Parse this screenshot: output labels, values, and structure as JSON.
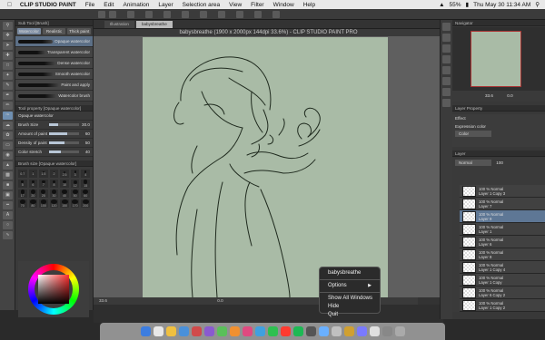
{
  "menubar": {
    "app": "CLIP STUDIO PAINT",
    "items": [
      "File",
      "Edit",
      "Animation",
      "Layer",
      "Selection area",
      "View",
      "Filter",
      "Window",
      "Help"
    ],
    "battery": "55%",
    "clock": "Thu May 30  11:34 AM"
  },
  "tool_panel": {
    "subtool_header": "Sub Tool [Brush]",
    "tabs": [
      "Watercolor",
      "Realistic",
      "Thick paint"
    ],
    "brushes": [
      "Opaque watercolor",
      "Transparent watercolor",
      "Dense watercolor",
      "Smooth watercolor",
      "Paint and apply",
      "Watercolor brush"
    ],
    "selected_brush": "Opaque watercolor",
    "prop_header": "Tool property [Opaque watercolor]",
    "prop_title": "Opaque watercolor",
    "props": [
      {
        "label": "Brush Size",
        "value": "30.0",
        "fill": 0.3
      },
      {
        "label": "Amount of paint",
        "value": "60",
        "fill": 0.6
      },
      {
        "label": "Density of paint",
        "value": "50",
        "fill": 0.5
      },
      {
        "label": "Color stretch",
        "value": "40",
        "fill": 0.4
      }
    ],
    "size_header": "Brush size [Opaque watercolor]",
    "sizes": [
      "0.7",
      "1",
      "1.5",
      "2",
      "2.5",
      "3",
      "4",
      "5",
      "6",
      "7",
      "8",
      "10",
      "12",
      "15",
      "17",
      "20",
      "25",
      "30",
      "40",
      "50",
      "60",
      "70",
      "80",
      "100",
      "120",
      "150",
      "170",
      "200"
    ]
  },
  "canvas": {
    "tabs": [
      "Illustration",
      "babysbreathe"
    ],
    "active_tab": "babysbreathe",
    "title": "babysbreathe (1900 x 2000px 144dpi 33.6%) - CLIP STUDIO PAINT PRO",
    "status_zoom": "33.6",
    "status_angle": "0.0"
  },
  "right_panel": {
    "navigator_tab": "Navigator",
    "nav_zoom": "33.6",
    "nav_angle": "0.0",
    "layer_property_tab": "Layer Property",
    "effect_label": "Effect",
    "expression_label": "Expression color",
    "expression_value": "Color",
    "layer_tab": "Layer",
    "blend_mode": "Normal",
    "opacity": "100",
    "layers": [
      {
        "pct": "100 % Normal",
        "name": "Layer 1 Copy 3",
        "selected": false
      },
      {
        "pct": "100 % Normal",
        "name": "Layer 7",
        "selected": false
      },
      {
        "pct": "100 % Normal",
        "name": "Layer 9",
        "selected": true
      },
      {
        "pct": "100 % Normal",
        "name": "Layer 1",
        "selected": false
      },
      {
        "pct": "100 % Normal",
        "name": "Layer 6",
        "selected": false
      },
      {
        "pct": "100 % Normal",
        "name": "Layer 8",
        "selected": false
      },
      {
        "pct": "100 % Normal",
        "name": "Layer 1 Copy 4",
        "selected": false
      },
      {
        "pct": "100 % Normal",
        "name": "Layer 1 Copy",
        "selected": false
      },
      {
        "pct": "100 % Normal",
        "name": "Layer 6 Copy 2",
        "selected": false
      },
      {
        "pct": "100 % Normal",
        "name": "Layer 1 Copy 2",
        "selected": false
      }
    ]
  },
  "context_menu": {
    "title": "babysbreathe",
    "options": "Options",
    "items": [
      "Show All Windows",
      "Hide",
      "Quit"
    ]
  },
  "dock_colors": [
    "#3c7de0",
    "#e8e8e8",
    "#f0c040",
    "#4a90d9",
    "#d04a4a",
    "#8a5ad0",
    "#5ac05a",
    "#f09030",
    "#e04a80",
    "#40a0e0",
    "#2ec050",
    "#ff3b30",
    "#1db954",
    "#555",
    "#6ab0ff",
    "#c0c0c0",
    "#d0a030",
    "#7a7aff",
    "#e0e0e0",
    "#888",
    "#aaa"
  ],
  "colors": {
    "canvas": "#a9bba6",
    "accent": "#5e7795",
    "ink": "#1f2a1e"
  }
}
